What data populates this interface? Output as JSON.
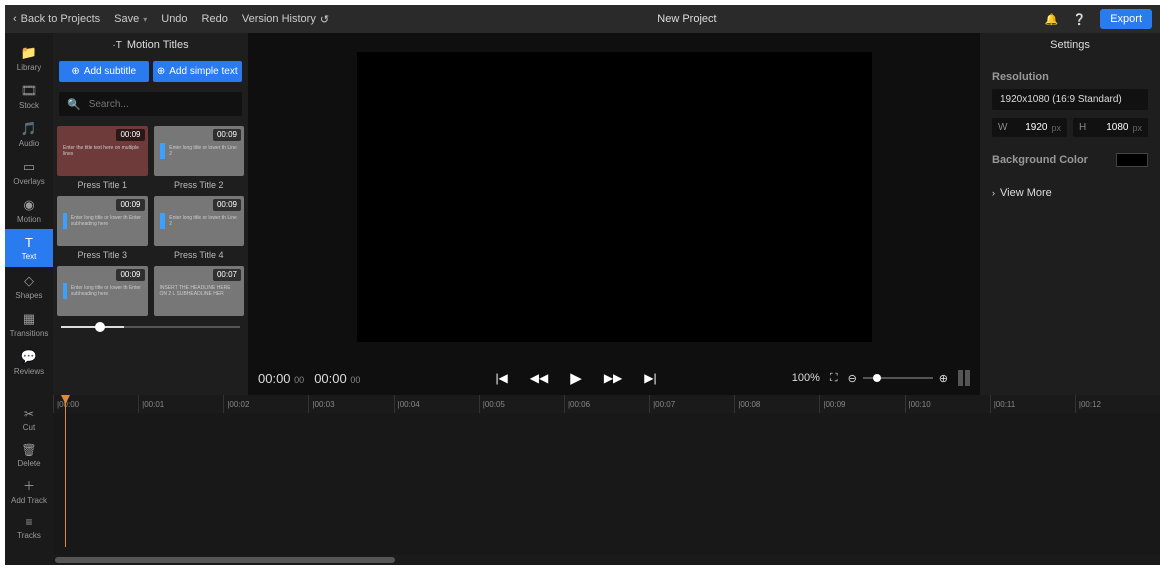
{
  "topbar": {
    "back": "Back to Projects",
    "save": "Save",
    "undo": "Undo",
    "redo": "Redo",
    "version_history": "Version History",
    "title": "New Project",
    "export": "Export"
  },
  "sidenav": [
    {
      "icon": "folder-icon",
      "glyph": "📁",
      "label": "Library"
    },
    {
      "icon": "stock-icon",
      "glyph": "🎞",
      "label": "Stock"
    },
    {
      "icon": "audio-icon",
      "glyph": "🎵",
      "label": "Audio"
    },
    {
      "icon": "overlays-icon",
      "glyph": "▭",
      "label": "Overlays"
    },
    {
      "icon": "motion-icon",
      "glyph": "◉",
      "label": "Motion"
    },
    {
      "icon": "text-icon",
      "glyph": "T",
      "label": "Text"
    },
    {
      "icon": "shapes-icon",
      "glyph": "◇",
      "label": "Shapes"
    },
    {
      "icon": "transitions-icon",
      "glyph": "▦",
      "label": "Transitions"
    },
    {
      "icon": "reviews-icon",
      "glyph": "💬",
      "label": "Reviews"
    }
  ],
  "panel": {
    "title": "Motion Titles",
    "btn1": "Add subtitle",
    "btn2": "Add simple text",
    "search_placeholder": "Search...",
    "tiles": [
      {
        "name": "Press Title 1",
        "duration": "00:09",
        "cls": "t1",
        "text": "Enter the title text here on multiple lines"
      },
      {
        "name": "Press Title 2",
        "duration": "00:09",
        "cls": "t2",
        "text": "Enter long title or lower th Line 2"
      },
      {
        "name": "Press Title 3",
        "duration": "00:09",
        "cls": "t3",
        "text": "Enter long title or lower th Enter subheading here"
      },
      {
        "name": "Press Title 4",
        "duration": "00:09",
        "cls": "t4",
        "text": "Enter long title or lower th Line 2"
      },
      {
        "name": "",
        "duration": "00:09",
        "cls": "t5",
        "text": "Enter long title or lower th Enter subheading here"
      },
      {
        "name": "",
        "duration": "00:07",
        "cls": "t6",
        "text": "INSERT THE HEADLINE HERE ON 2 L SUBHEADLINE HER"
      }
    ]
  },
  "preview": {
    "time_current": "00:00",
    "time_current_ms": "00",
    "time_total": "00:00",
    "time_total_ms": "00",
    "zoom": "100%"
  },
  "settings": {
    "title": "Settings",
    "resolution_label": "Resolution",
    "resolution_value": "1920x1080 (16:9 Standard)",
    "w_label": "W",
    "w_value": "1920",
    "w_unit": "px",
    "h_label": "H",
    "h_value": "1080",
    "h_unit": "px",
    "bg_label": "Background Color",
    "bg_color": "#000000",
    "view_more": "View More"
  },
  "timeline": {
    "tools": [
      {
        "glyph": "✂",
        "label": "Cut"
      },
      {
        "glyph": "🗑",
        "label": "Delete"
      },
      {
        "glyph": "＋",
        "label": "Add Track"
      },
      {
        "glyph": "≡",
        "label": "Tracks"
      }
    ],
    "ticks": [
      "|00:00",
      "|00:01",
      "|00:02",
      "|00:03",
      "|00:04",
      "|00:05",
      "|00:06",
      "|00:07",
      "|00:08",
      "|00:09",
      "|00:10",
      "|00:11",
      "|00:12"
    ]
  }
}
